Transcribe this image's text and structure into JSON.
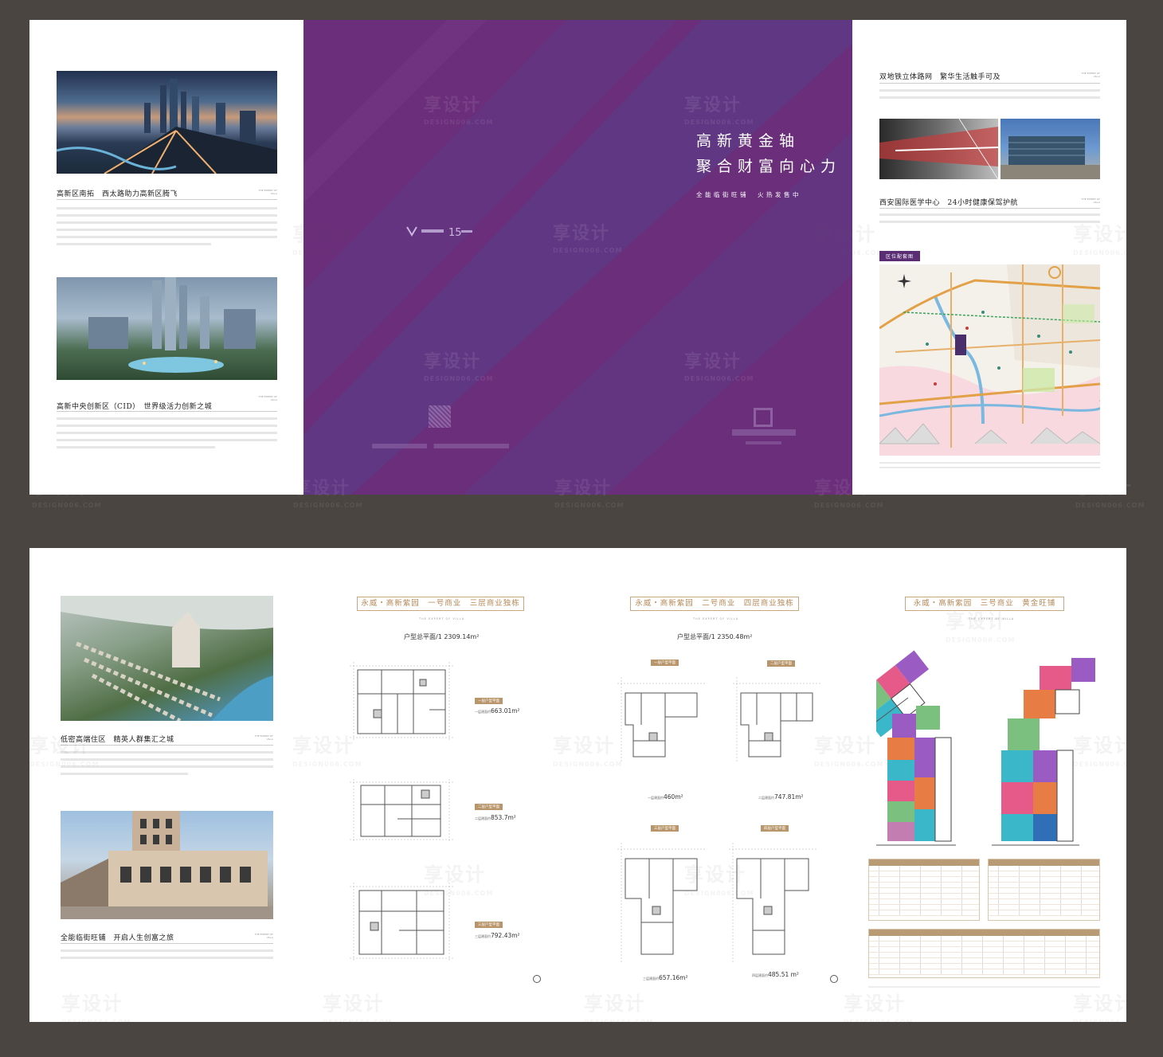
{
  "top": {
    "left_panel": {
      "section1_title": "高新区南拓　西太路助力高新区腾飞",
      "section2_title": "高新中央创新区（CID）　世界级活力创新之城",
      "expert_label": "THE EXPERT OF VILLA"
    },
    "cover": {
      "slogan_line1": "高新黄金轴",
      "slogan_line2": "聚合财富向心力",
      "tagline": "全能临街旺铺　火热发售中"
    },
    "right_panel": {
      "section1_title": "双地铁立体路网　繁华生活触手可及",
      "section2_title": "西安国际医学中心　24小时健康保驾护航",
      "map_label": "区位配套图",
      "expert_label": "THE EXPERT OF VILLA"
    }
  },
  "bottom": {
    "left_panel": {
      "section1_title": "低密高端住区　精英人群集汇之城",
      "section2_title": "全能临街旺铺　开启人生创富之旅",
      "expert_label": "THE EXPERT OF VILLA"
    },
    "plan1": {
      "title": "永威・高新紫园　一号商业　三层商业独栋",
      "subtitle": "THE EXPERT OF VILLA",
      "total_area": "户型总平面/1 2309.14m²",
      "floors": [
        {
          "tag": "一层户型平面",
          "area_label": "一层建面约",
          "area": "663.01m²"
        },
        {
          "tag": "二层户型平面",
          "area_label": "二层建面约",
          "area": "853.7m²"
        },
        {
          "tag": "三层户型平面",
          "area_label": "三层建面约",
          "area": "792.43m²"
        }
      ]
    },
    "plan2": {
      "title": "永威・高新紫园　二号商业　四层商业独栋",
      "subtitle": "THE EXPERT OF VILLA",
      "total_area": "户型总平面/1 2350.48m²",
      "floors": [
        {
          "tag": "一层户型平面",
          "area_label": "一层建面约",
          "area": "460m²"
        },
        {
          "tag": "二层户型平面",
          "area_label": "二层建面约",
          "area": "747.81m²"
        },
        {
          "tag": "三层户型平面",
          "area_label": "三层建面约",
          "area": "657.16m²"
        },
        {
          "tag": "四层户型平面",
          "area_label": "四层建面约",
          "area": "485.51 m²"
        }
      ]
    },
    "plan3": {
      "title": "永威・高新紫园　三号商业　黄金旺铺",
      "subtitle": "THE EXPERT OF VILLA"
    }
  },
  "watermark": {
    "cn": "享设计",
    "en": "DESIGN006.COM"
  },
  "colors": {
    "purple": "#6a2e7a",
    "gold": "#b8956a",
    "frame": "#4b4541"
  }
}
